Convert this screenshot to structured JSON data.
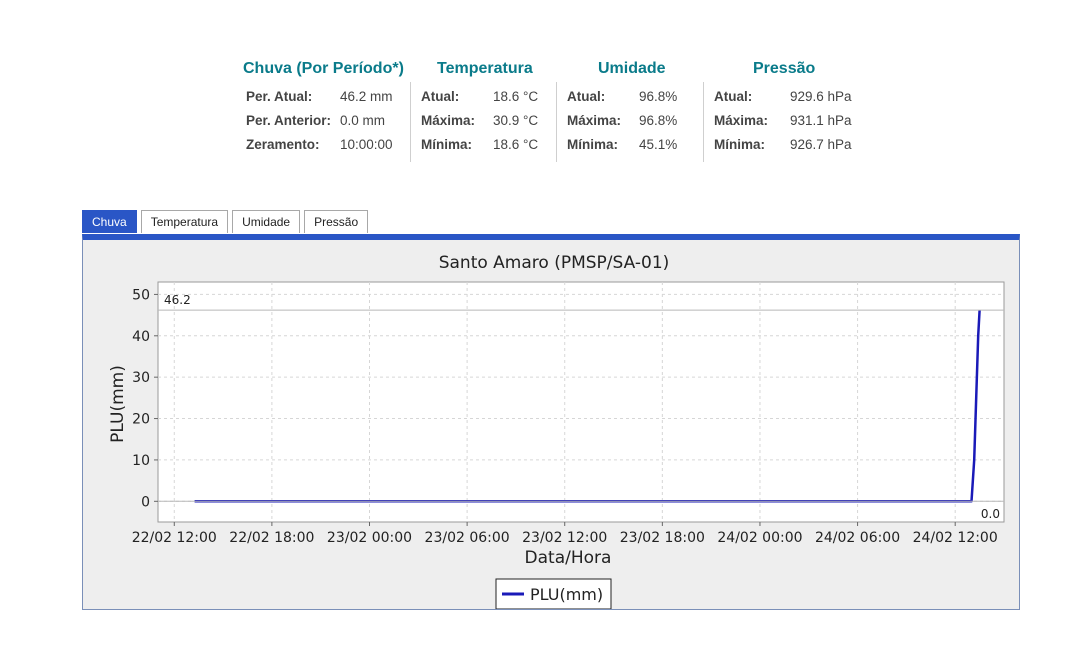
{
  "stats": {
    "chuva": {
      "title": "Chuva (Por Período*)",
      "rows": [
        {
          "label": "Per. Atual:",
          "value": "46.2 mm"
        },
        {
          "label": "Per. Anterior:",
          "value": "0.0 mm"
        },
        {
          "label": "Zeramento:",
          "value": "10:00:00"
        }
      ]
    },
    "temperatura": {
      "title": "Temperatura",
      "rows": [
        {
          "label": "Atual:",
          "value": "18.6 °C"
        },
        {
          "label": "Máxima:",
          "value": "30.9 °C"
        },
        {
          "label": "Mínima:",
          "value": "18.6 °C"
        }
      ]
    },
    "umidade": {
      "title": "Umidade",
      "rows": [
        {
          "label": "Atual:",
          "value": "96.8%"
        },
        {
          "label": "Máxima:",
          "value": "96.8%"
        },
        {
          "label": "Mínima:",
          "value": "45.1%"
        }
      ]
    },
    "pressao": {
      "title": "Pressão",
      "rows": [
        {
          "label": "Atual:",
          "value": "929.6 hPa"
        },
        {
          "label": "Máxima:",
          "value": "931.1 hPa"
        },
        {
          "label": "Mínima:",
          "value": "926.7 hPa"
        }
      ]
    }
  },
  "tabs": [
    {
      "label": "Chuva",
      "active": true
    },
    {
      "label": "Temperatura",
      "active": false
    },
    {
      "label": "Umidade",
      "active": false
    },
    {
      "label": "Pressão",
      "active": false
    }
  ],
  "colors": {
    "accent": "#2a56c6",
    "heading": "#0a7b8a",
    "series": "#1a1ab8"
  },
  "chart_data": {
    "type": "line",
    "title": "Santo Amaro (PMSP/SA-01)",
    "xlabel": "Data/Hora",
    "ylabel": "PLU(mm)",
    "xlim": [
      "2024-02-22 11:00",
      "2024-02-24 15:00"
    ],
    "ylim": [
      -5,
      53
    ],
    "y_ticks": [
      0,
      10,
      20,
      30,
      40,
      50
    ],
    "x_ticks": [
      {
        "label": "22/02 12:00",
        "t": "2024-02-22 12:00"
      },
      {
        "label": "22/02 18:00",
        "t": "2024-02-22 18:00"
      },
      {
        "label": "23/02 00:00",
        "t": "2024-02-23 00:00"
      },
      {
        "label": "23/02 06:00",
        "t": "2024-02-23 06:00"
      },
      {
        "label": "23/02 12:00",
        "t": "2024-02-23 12:00"
      },
      {
        "label": "23/02 18:00",
        "t": "2024-02-23 18:00"
      },
      {
        "label": "24/02 00:00",
        "t": "2024-02-24 00:00"
      },
      {
        "label": "24/02 06:00",
        "t": "2024-02-24 06:00"
      },
      {
        "label": "24/02 12:00",
        "t": "2024-02-24 12:00"
      }
    ],
    "grid": true,
    "legend_position": "bottom",
    "series": [
      {
        "name": "PLU(mm)",
        "points": [
          {
            "t": "2024-02-22 13:15",
            "y": 0
          },
          {
            "t": "2024-02-24 13:00",
            "y": 0
          },
          {
            "t": "2024-02-24 13:10",
            "y": 10
          },
          {
            "t": "2024-02-24 13:25",
            "y": 40
          },
          {
            "t": "2024-02-24 13:30",
            "y": 46.2
          }
        ]
      }
    ],
    "annotations": [
      {
        "text": "46.2",
        "y": 46.2,
        "position": "top-left"
      },
      {
        "text": "0.0",
        "y": 0,
        "position": "bottom-right"
      }
    ]
  }
}
